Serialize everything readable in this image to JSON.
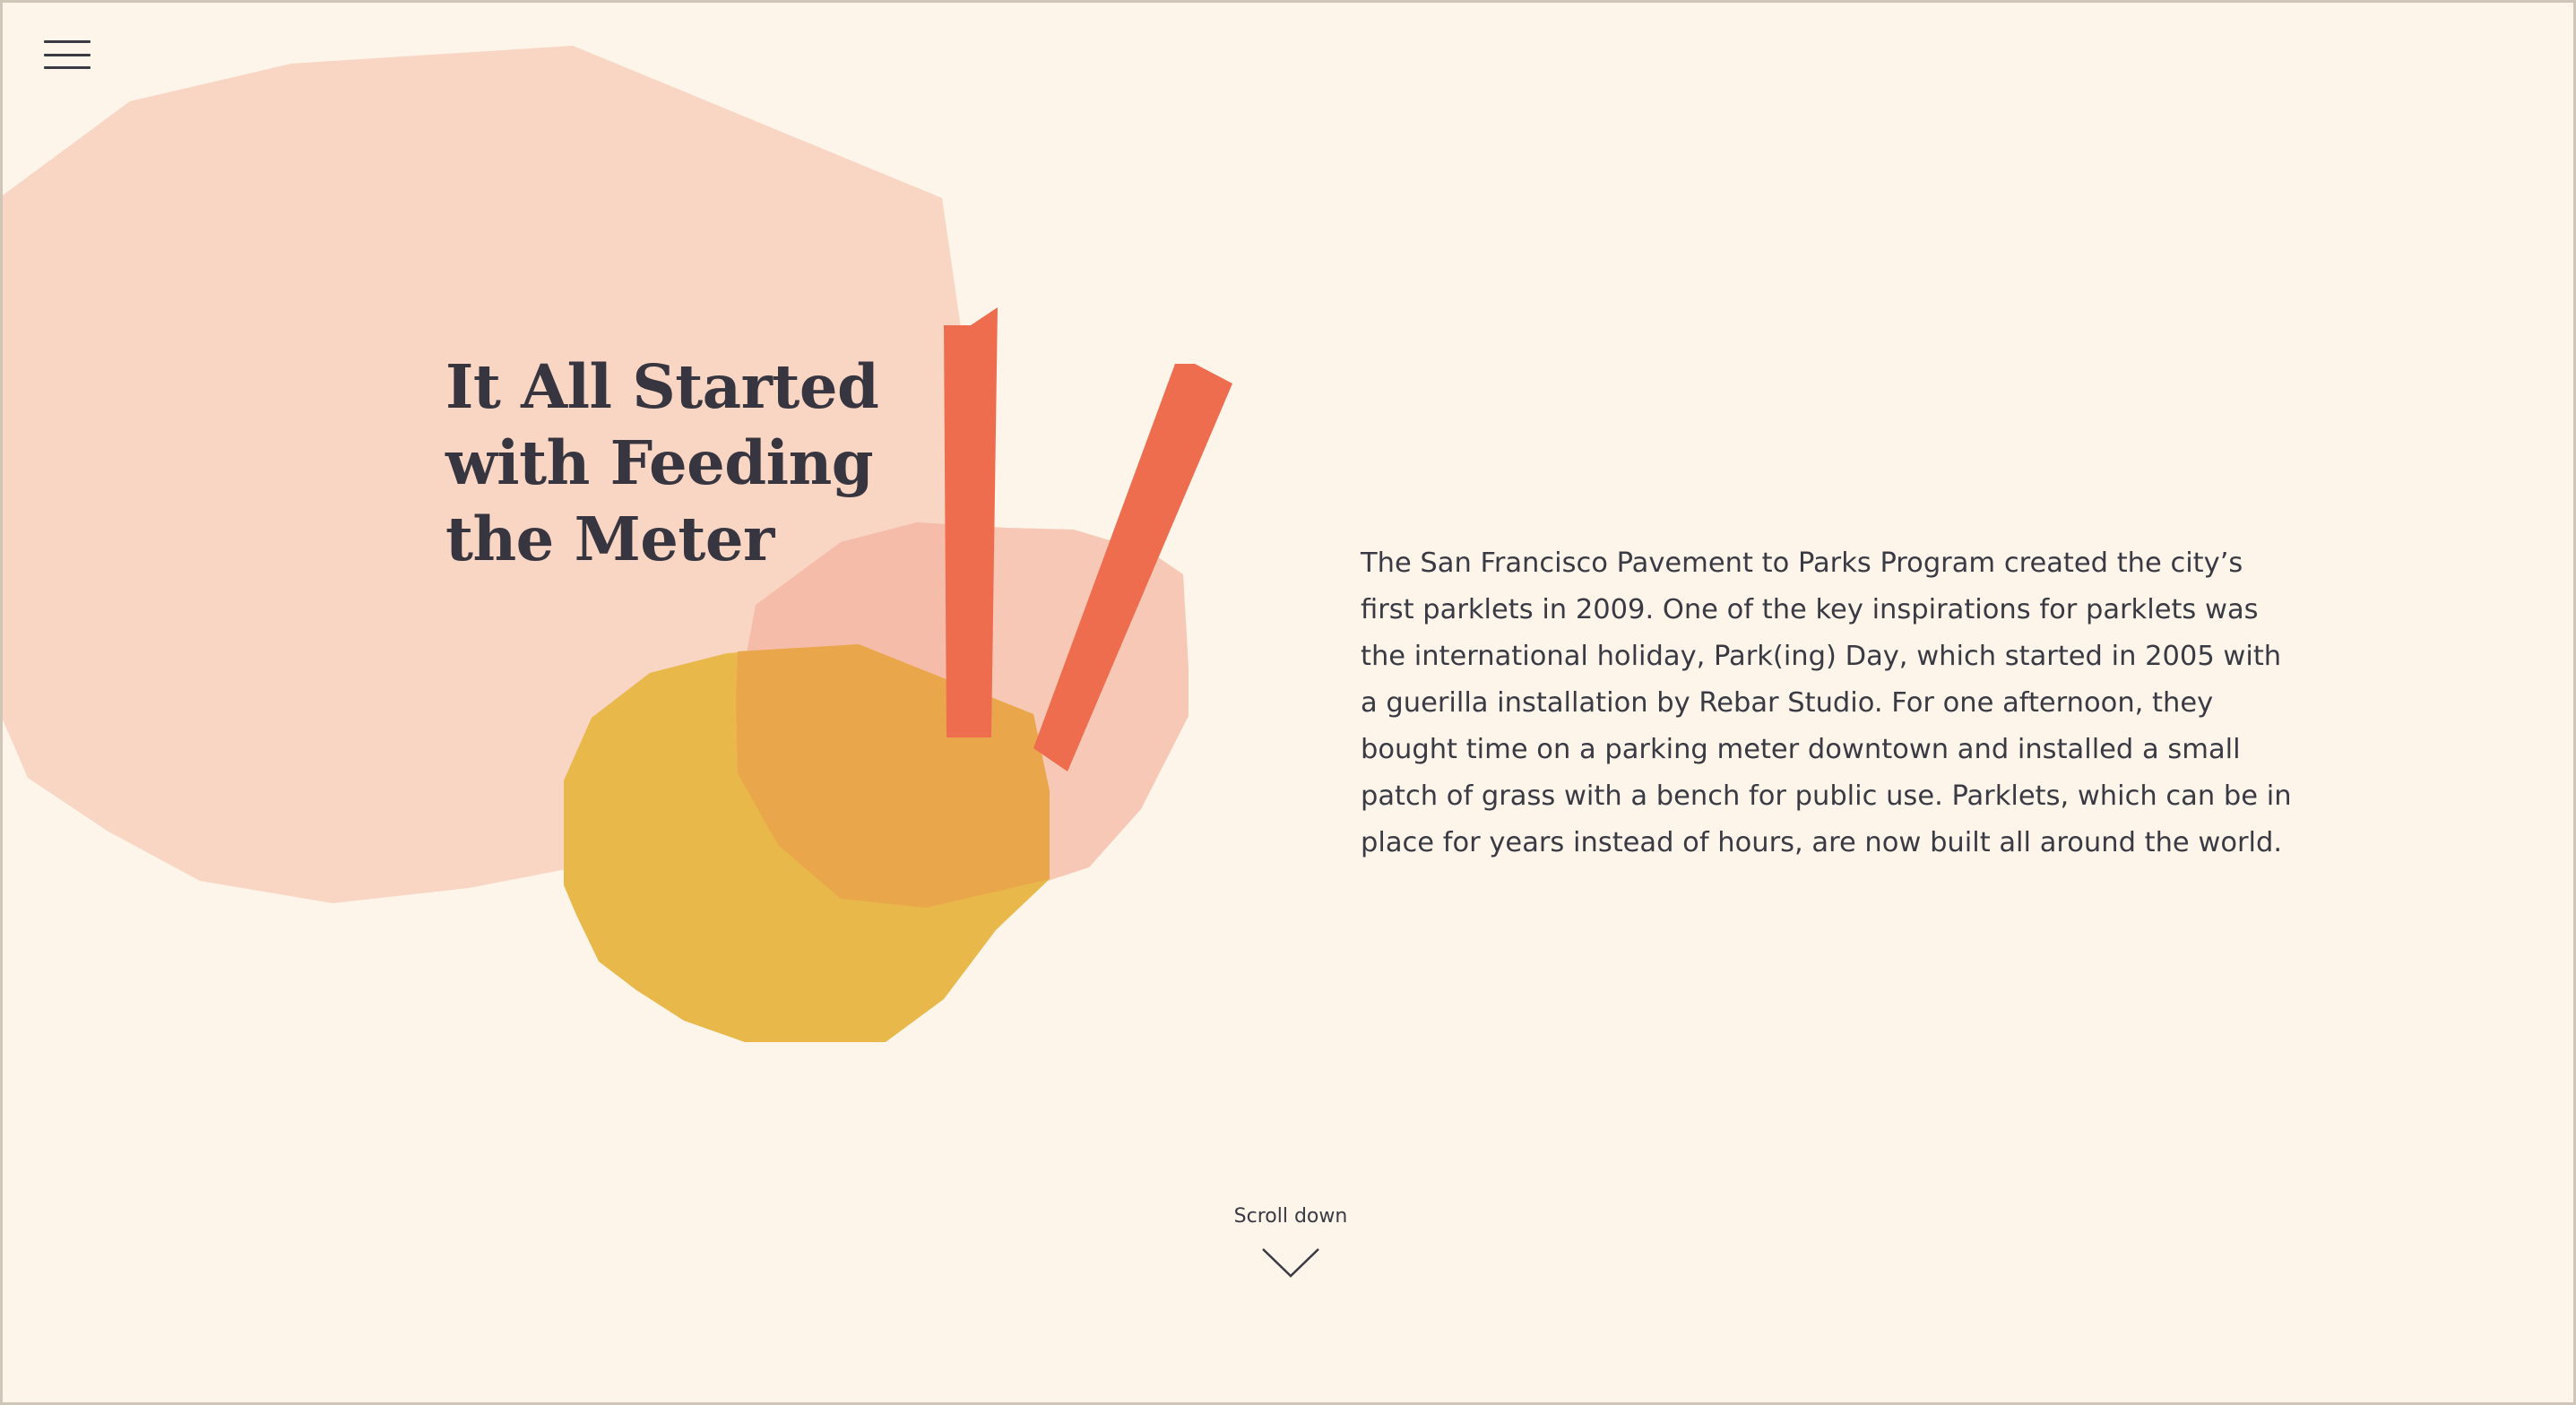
{
  "nav": {
    "menu_icon": "hamburger-menu-icon"
  },
  "hero": {
    "title_lines": [
      "It All Started",
      "with Feeding",
      "the Meter"
    ],
    "intro_text": "The San Francisco Pavement to Parks Program created the city’s first parklets in 2009. One of the key inspirations for parklets was the international holiday, Park(ing) Day, which started in 2005 with a guerilla installation by Rebar Studio. For one afternoon, they bought time on a parking meter downtown and installed a small patch of grass with a bench for public use. Parklets, which can be in place for years instead of hours, are now built all around the world."
  },
  "scroll": {
    "label": "Scroll down",
    "icon": "chevron-down-icon"
  },
  "colors": {
    "background": "#fdf4ea",
    "page_border": "#cfc6b8",
    "text": "#363540",
    "blob_peach": "#f9d5c3",
    "blob_peach_overlap": "#f6bcaa",
    "blob_yellow": "#e8b84b",
    "blob_yellow_overlap": "#eaa64b",
    "accent_red": "#ee6d4f"
  }
}
